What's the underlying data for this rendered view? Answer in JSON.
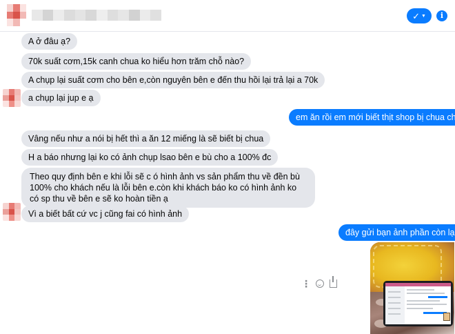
{
  "header": {
    "contact_name": "",
    "action_icon": "check-caret-icon",
    "info_icon": "i"
  },
  "messages": [
    {
      "dir": "in",
      "text": "A ở đâu ạ?"
    },
    {
      "dir": "in",
      "text": "70k suất cơm,15k canh chua ko hiểu hơn trăm chỗ nào?"
    },
    {
      "dir": "in",
      "text": "A chụp lại suất cơm cho bên e,còn nguyên bên e đến thu hồi lại trả lại a 70k"
    },
    {
      "dir": "in",
      "text": "a chụp lại jup e  ạ"
    },
    {
      "dir": "out",
      "text": "em ăn rồi em mới biết thịt shop bị chua chứ"
    },
    {
      "dir": "in",
      "text": "Vâng nếu như a nói bị hết thì a ăn 12 miếng là sẽ biết bị chua"
    },
    {
      "dir": "in",
      "text": "H a báo nhưng lại ko có ảnh chụp lsao bên e bù cho a 100% đc"
    },
    {
      "dir": "in",
      "text": "Theo quy định bên e khi lỗi sẽ c ó hình ảnh vs sản phẩm thu về đền bù 100% cho khách nếu là lỗi bên e.còn khi khách báo ko có hình ảnh ko có sp thu về bên e sẽ ko hoàn tiền ạ"
    },
    {
      "dir": "in",
      "text": "Vì a biết bất cứ vc j cũng fai có hình ảnh"
    },
    {
      "dir": "out",
      "text": "đây gửi bạn ảnh phần còn lại"
    }
  ],
  "colors": {
    "incoming_bubble": "#e4e6eb",
    "outgoing_bubble": "#0a7cff",
    "avatar_pixels": [
      "#f2b9b5",
      "#e77b74",
      "#f6d3d0",
      "#eaa09a",
      "#d9534a",
      "#f4c4c0",
      "#fbe3e1",
      "#ee9088",
      "#f8d8d5"
    ]
  },
  "attachment": {
    "type": "photo",
    "tools": [
      "more-icon",
      "emoji-icon",
      "share-icon"
    ]
  }
}
